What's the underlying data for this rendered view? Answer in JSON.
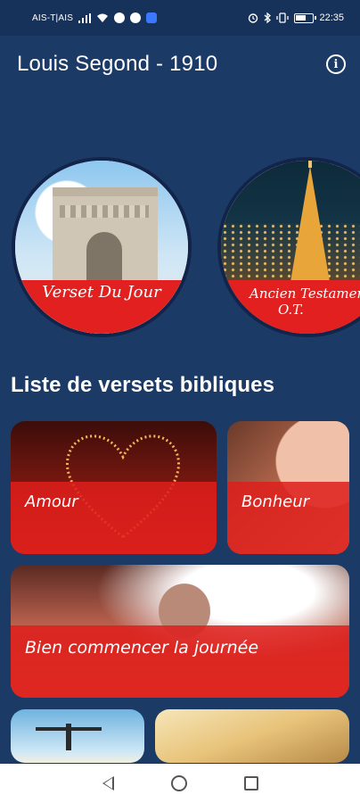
{
  "status_bar": {
    "carrier": "AIS-T|AIS",
    "time": "22:35",
    "icons_left": [
      "signal-icon",
      "wifi-icon",
      "messenger-icon",
      "sync-icon",
      "vpn-icon"
    ],
    "icons_right": [
      "alarm-icon",
      "bluetooth-icon",
      "vibrate-icon",
      "battery-icon"
    ]
  },
  "app_bar": {
    "title": "Louis Segond - 1910",
    "info_icon": "info-icon"
  },
  "carousel": {
    "items": [
      {
        "label": "Verset Du Jour",
        "image": "arc-de-triomphe"
      },
      {
        "label": "Ancien Testamen\nO.T.",
        "image": "eiffel-tower-night"
      }
    ]
  },
  "section": {
    "title": "Liste de versets bibliques"
  },
  "cards": [
    {
      "label": "Amour",
      "image": "light-heart"
    },
    {
      "label": "Bonheur",
      "image": "smiling-woman"
    },
    {
      "label": "Bien commencer la journée",
      "image": "raised-hand-sunrise"
    },
    {
      "label": "",
      "image": "person-sky"
    },
    {
      "label": "",
      "image": "golden-light"
    }
  ],
  "colors": {
    "background": "#1b3a66",
    "accent_red": "#e2201f",
    "text": "#ffffff"
  },
  "nav_bar": {
    "buttons": [
      "back-icon",
      "home-icon",
      "recent-apps-icon"
    ]
  }
}
